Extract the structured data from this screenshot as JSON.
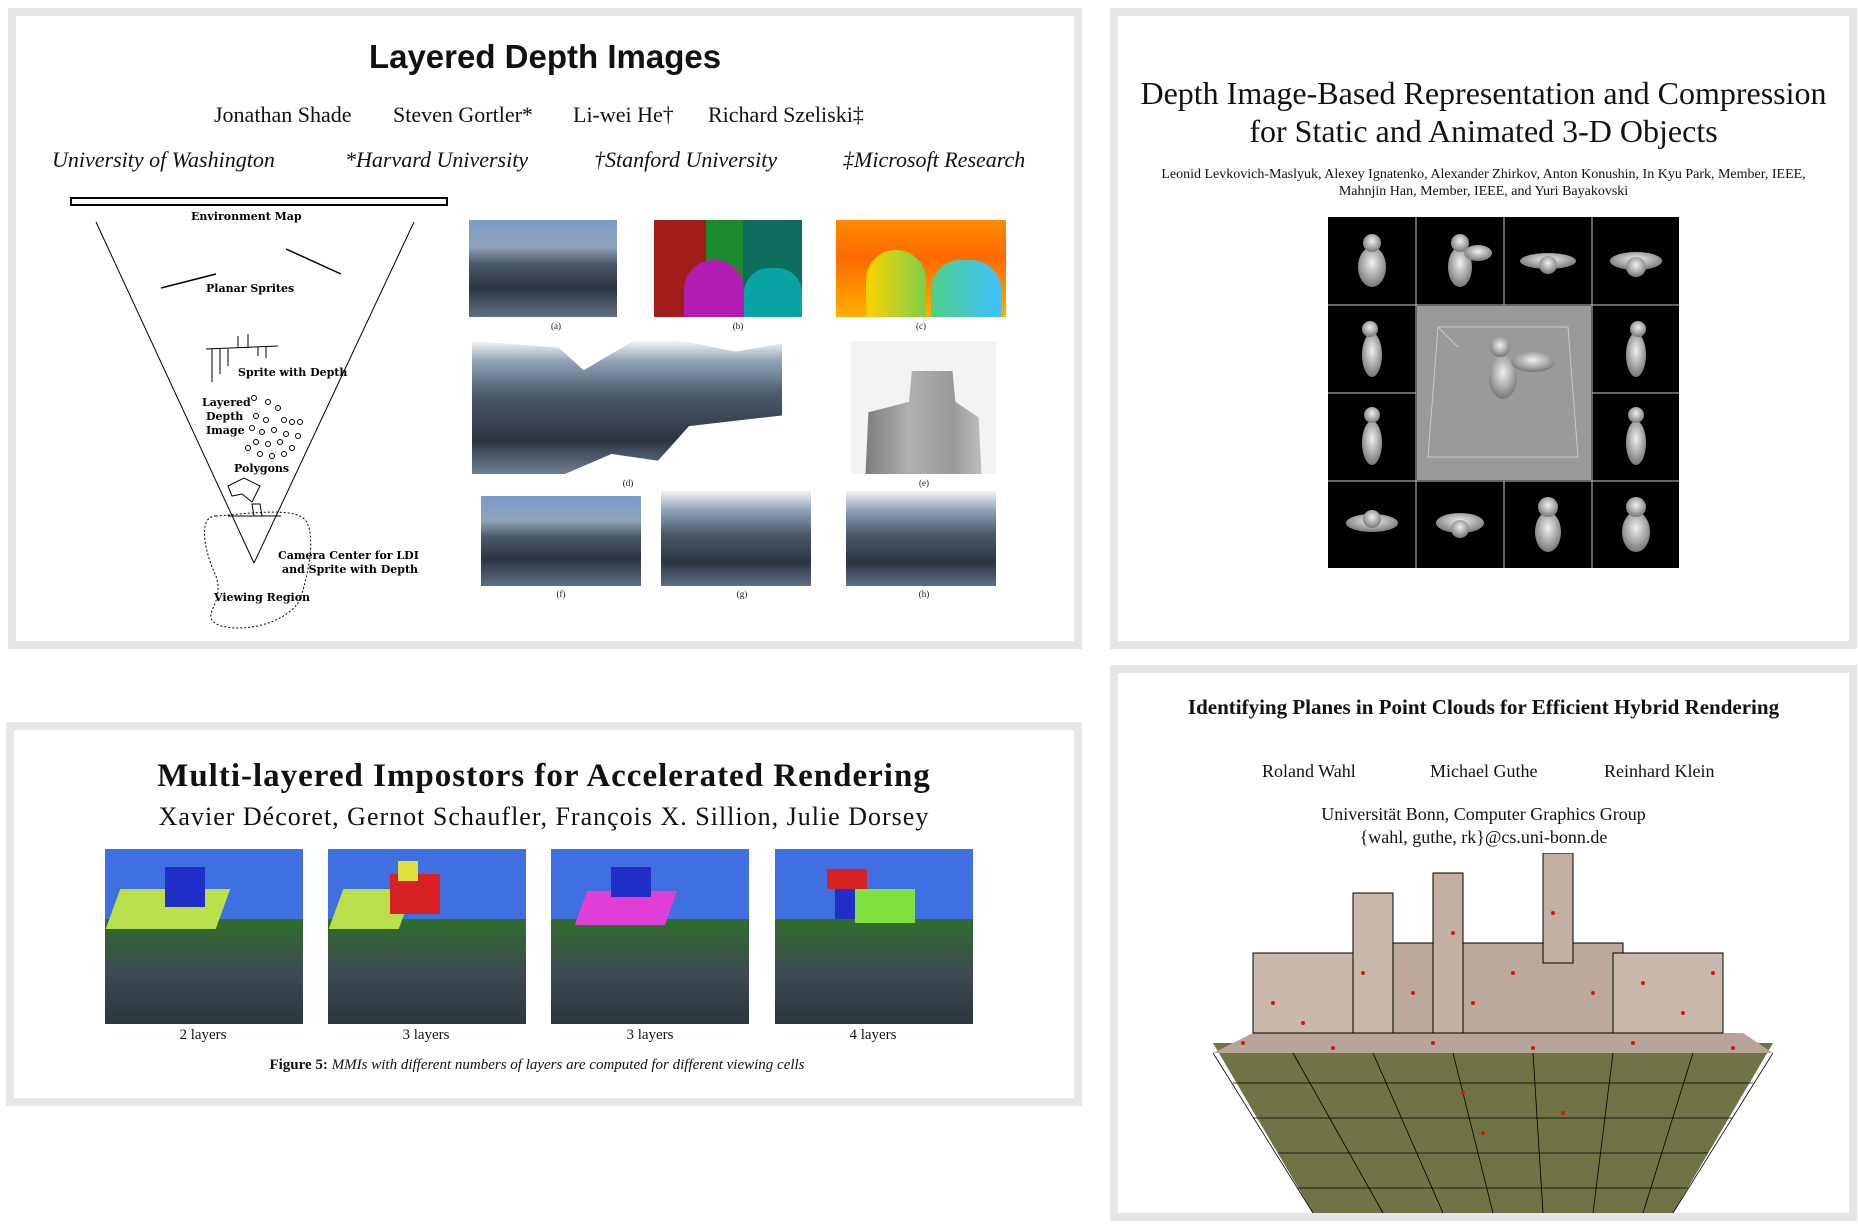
{
  "ldi": {
    "title": "Layered Depth Images",
    "authors": [
      "Jonathan Shade",
      "Steven Gortler*",
      "Li-wei He†",
      "Richard Szeliski‡"
    ],
    "affiliations": [
      "University of Washington",
      "*Harvard University",
      "†Stanford University",
      "‡Microsoft Research"
    ],
    "diagram_labels": {
      "env_map": "Environment Map",
      "planar_sprites": "Planar Sprites",
      "sprite_depth": "Sprite with Depth",
      "ldi_1": "Layered",
      "ldi_2": "Depth",
      "ldi_3": "Image",
      "polygons": "Polygons",
      "camera_1": "Camera Center for LDI",
      "camera_2": "and Sprite with Depth",
      "viewing_region": "Viewing Region"
    },
    "captions": [
      "(a)",
      "(b)",
      "(c)",
      "(d)",
      "(e)",
      "(f)",
      "(g)",
      "(h)"
    ]
  },
  "dibr": {
    "title_line1": "Depth Image-Based Representation and Compression",
    "title_line2": "for Static and Animated 3-D Objects",
    "authors_line1": "Leonid Levkovich-Maslyuk, Alexey Ignatenko, Alexander Zhirkov, Anton Konushin, In Kyu Park, Member, IEEE,",
    "authors_line2": "Mahnjin Han, Member, IEEE, and Yuri Bayakovski"
  },
  "mmi": {
    "title": "Multi-layered Impostors for Accelerated Rendering",
    "authors": "Xavier Décoret, Gernot Schaufler, François X. Sillion, Julie Dorsey",
    "panel_captions": [
      "2 layers",
      "3 layers",
      "3 layers",
      "4 layers"
    ],
    "figure_label": "Figure 5:",
    "figure_caption": "MMIs with different numbers of layers are computed for different viewing cells",
    "colors": {
      "sky": "#3f6fe0",
      "ground": "#2f6e2a",
      "rock": "#3d4a52"
    }
  },
  "pc": {
    "title": "Identifying Planes in Point Clouds for Efficient Hybrid Rendering",
    "authors": [
      "Roland Wahl",
      "Michael Guthe",
      "Reinhard Klein"
    ],
    "affil_line1": "Universität Bonn, Computer Graphics Group",
    "affil_line2": "{wahl, guthe, rk}@cs.uni-bonn.de"
  }
}
